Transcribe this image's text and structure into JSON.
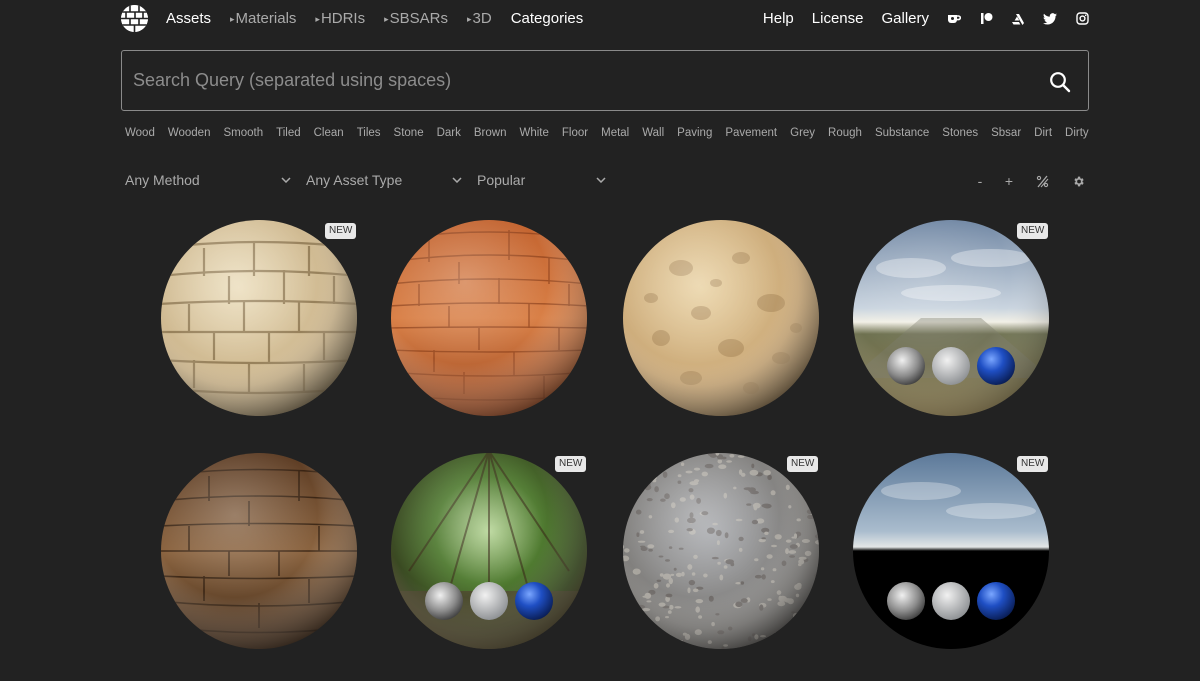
{
  "nav": {
    "assets": "Assets",
    "materials": "Materials",
    "hdris": "HDRIs",
    "sbsars": "SBSARs",
    "three_d": "3D",
    "categories": "Categories",
    "help": "Help",
    "license": "License",
    "gallery": "Gallery",
    "arrow_glyph": "▸",
    "icons": [
      "ko-fi-icon",
      "patreon-icon",
      "artstation-icon",
      "twitter-icon",
      "instagram-icon"
    ]
  },
  "search": {
    "placeholder": "Search Query (separated using spaces)",
    "value": ""
  },
  "tags": [
    "Wood",
    "Wooden",
    "Smooth",
    "Tiled",
    "Clean",
    "Tiles",
    "Stone",
    "Dark",
    "Brown",
    "White",
    "Floor",
    "Metal",
    "Wall",
    "Paving",
    "Pavement",
    "Grey",
    "Rough",
    "Substance",
    "Stones",
    "Sbsar",
    "Dirt",
    "Dirty"
  ],
  "filters": {
    "method": "Any Method",
    "asset_type": "Any Asset Type",
    "sort": "Popular"
  },
  "view_controls": {
    "zoom_out": "-",
    "zoom_in": "+"
  },
  "assets": [
    {
      "kind": "material",
      "subject": "stone-bricks",
      "badge": "NEW"
    },
    {
      "kind": "material",
      "subject": "wood-planks-orange",
      "badge": ""
    },
    {
      "kind": "material",
      "subject": "sandstone",
      "badge": ""
    },
    {
      "kind": "hdri",
      "subject": "field-sky",
      "badge": "NEW"
    },
    {
      "kind": "material",
      "subject": "wood-planks-brown",
      "badge": ""
    },
    {
      "kind": "hdri",
      "subject": "forest",
      "badge": "NEW"
    },
    {
      "kind": "material",
      "subject": "gravel",
      "badge": "NEW"
    },
    {
      "kind": "hdri",
      "subject": "sky-dark-ground",
      "badge": "NEW"
    }
  ],
  "colors": {
    "background": "#222222",
    "badge_bg": "#e8e8e8",
    "text_muted": "#aaaaaa"
  }
}
